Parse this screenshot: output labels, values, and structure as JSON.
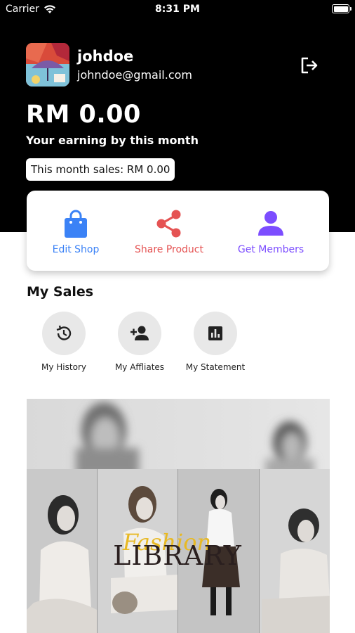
{
  "status_bar": {
    "carrier": "Carrier",
    "time": "8:31 PM"
  },
  "profile": {
    "name": "johdoe",
    "email": "johndoe@gmail.com"
  },
  "earnings": {
    "amount": "RM 0.00",
    "caption": "Your earning by this month",
    "month_sales": "This month sales: RM 0.00"
  },
  "actions": [
    {
      "label": "Edit Shop",
      "icon": "shopping-bag-icon",
      "color": "#3b82f6"
    },
    {
      "label": "Share Product",
      "icon": "share-icon",
      "color": "#e55353"
    },
    {
      "label": "Get Members",
      "icon": "person-icon",
      "color": "#7c4dff"
    }
  ],
  "my_sales": {
    "title": "My Sales",
    "items": [
      {
        "label": "My History",
        "icon": "history-icon"
      },
      {
        "label": "My Affliates",
        "icon": "person-add-icon"
      },
      {
        "label": "My Statement",
        "icon": "bar-chart-icon"
      }
    ]
  },
  "banner": {
    "script_text": "Fashion",
    "title": "LIBRARY"
  }
}
